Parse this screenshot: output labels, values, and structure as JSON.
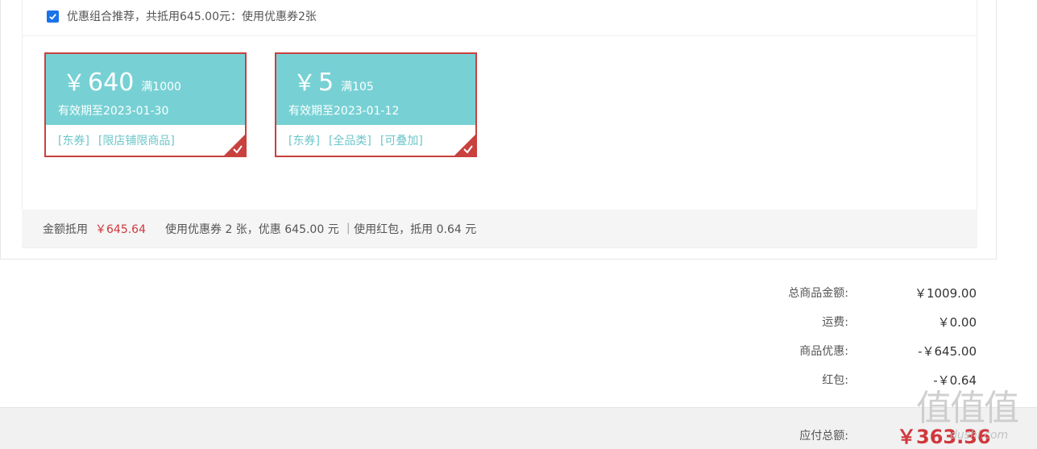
{
  "combo": {
    "checked": true,
    "text": "优惠组合推荐，共抵用645.00元：使用优惠券2张"
  },
  "coupons": [
    {
      "currency": "￥",
      "amount": "640",
      "threshold": "满1000",
      "validity": "有效期至2023-01-30",
      "tags": [
        "[东券]",
        "[限店铺限商品]"
      ],
      "selected": true
    },
    {
      "currency": "￥",
      "amount": "5",
      "threshold": "满105",
      "validity": "有效期至2023-01-12",
      "tags": [
        "[东券]",
        "[全品类]",
        "[可叠加]"
      ],
      "selected": true
    }
  ],
  "summary": {
    "deduct_label": "金额抵用",
    "deduct_value": "￥645.64",
    "detail": "使用优惠券 2 张，优惠 645.00 元 ｜使用红包，抵用 0.64 元"
  },
  "totals": [
    {
      "label": "总商品金额:",
      "value": "￥1009.00"
    },
    {
      "label": "运费:",
      "value": "￥0.00"
    },
    {
      "label": "商品优惠:",
      "value": "-￥645.00"
    },
    {
      "label": "红包:",
      "value": "-￥0.64"
    }
  ],
  "payable": {
    "label": "应付总额:",
    "value": "￥363.36"
  },
  "watermark": {
    "text": "值值值",
    "sub": "dushi.com"
  },
  "colors": {
    "coupon_bg": "#77d1d4",
    "coupon_border": "#c8413e",
    "accent_red": "#d0373c",
    "checkbox_blue": "#1a73e8"
  }
}
